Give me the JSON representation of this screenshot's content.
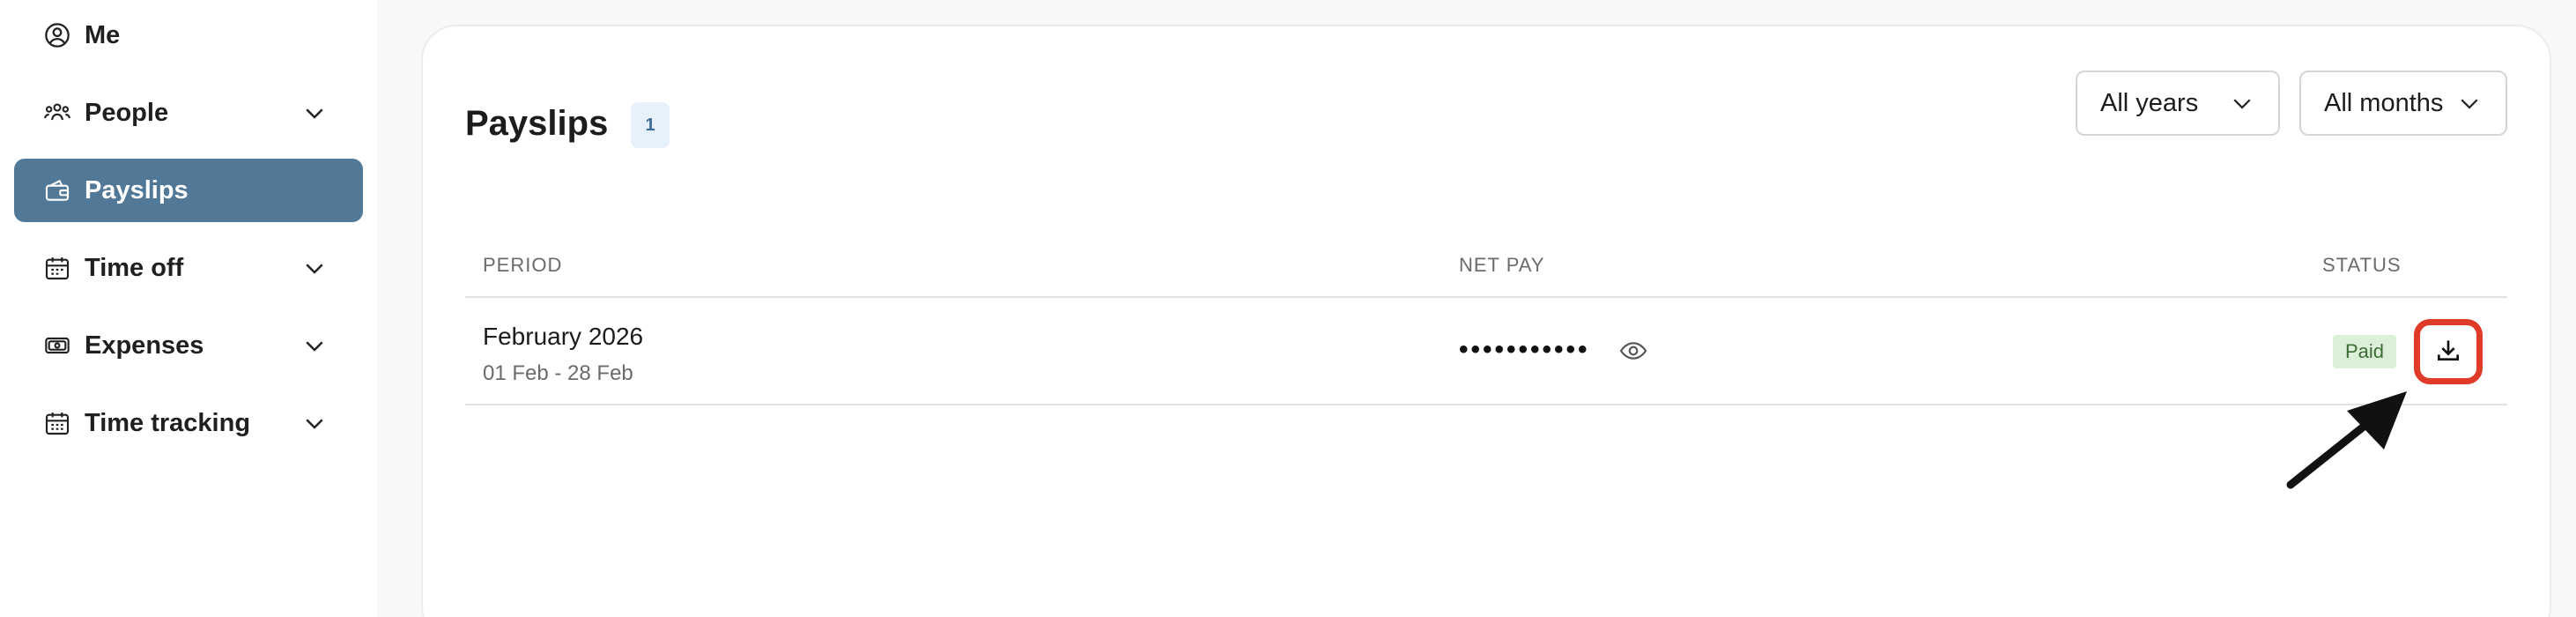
{
  "sidebar": {
    "items": [
      {
        "label": "Me",
        "icon": "user-circle-icon",
        "expandable": false
      },
      {
        "label": "People",
        "icon": "people-icon",
        "expandable": true
      },
      {
        "label": "Payslips",
        "icon": "wallet-icon",
        "expandable": false,
        "active": true
      },
      {
        "label": "Time off",
        "icon": "calendar-icon",
        "expandable": true
      },
      {
        "label": "Expenses",
        "icon": "money-icon",
        "expandable": true
      },
      {
        "label": "Time tracking",
        "icon": "calendar-clock-icon",
        "expandable": true
      }
    ]
  },
  "main": {
    "title": "Payslips",
    "count": "1",
    "filters": {
      "years": "All years",
      "months": "All months"
    },
    "table": {
      "columns": {
        "period": "PERIOD",
        "net_pay": "NET PAY",
        "status": "STATUS"
      },
      "rows": [
        {
          "period": "February 2026",
          "range": "01 Feb - 28 Feb",
          "net_pay_masked": "•••••••••••",
          "status": "Paid"
        }
      ]
    }
  },
  "colors": {
    "active_nav": "#527898",
    "status_paid_bg": "#dcefd8",
    "highlight_border": "#e03b28"
  }
}
